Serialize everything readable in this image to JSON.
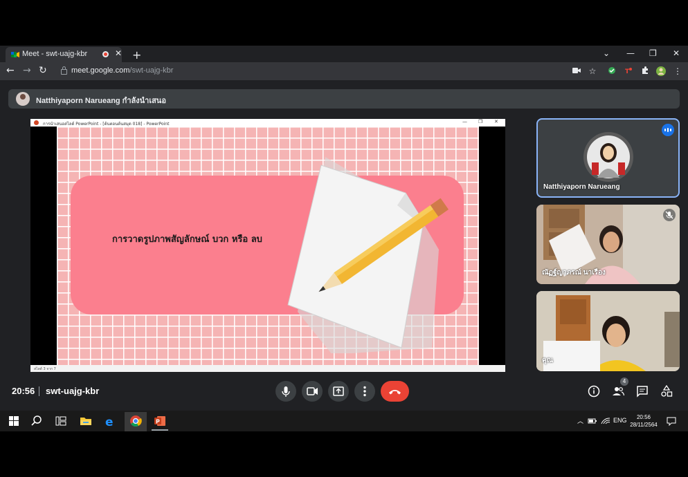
{
  "browser": {
    "tab_title": "Meet - swt-uajg-kbr",
    "url_host": "meet.google.com",
    "url_path": "/swt-uajg-kbr"
  },
  "meet": {
    "presenting_text": "Natthiyaporn Narueang กำลังนำเสนอ",
    "slide_title": "การวาดรูปภาพสัญลักษณ์ บวก หรือ ลบ",
    "ppt_window_title": "การนำเสนอสไลด์ PowerPoint - [ต้นตอนต้นสมุด 018] - PowerPoint",
    "ppt_status": "สไลด์ 3 จาก 7",
    "participants": [
      {
        "name": "Natthiyaporn Narueang"
      },
      {
        "name": "ณัฏฐ์ญาภรณ์ นาเรือง"
      },
      {
        "name": "คุณ"
      }
    ],
    "clock": "20:56",
    "meeting_code": "swt-uajg-kbr",
    "people_count": "4"
  },
  "taskbar": {
    "lang": "ENG",
    "time": "20:56",
    "date": "28/11/2564"
  },
  "colors": {
    "meet_bg": "#202124",
    "end_call": "#ea4335",
    "accent": "#8ab4f8",
    "slide_pink": "#fb7f8e"
  }
}
